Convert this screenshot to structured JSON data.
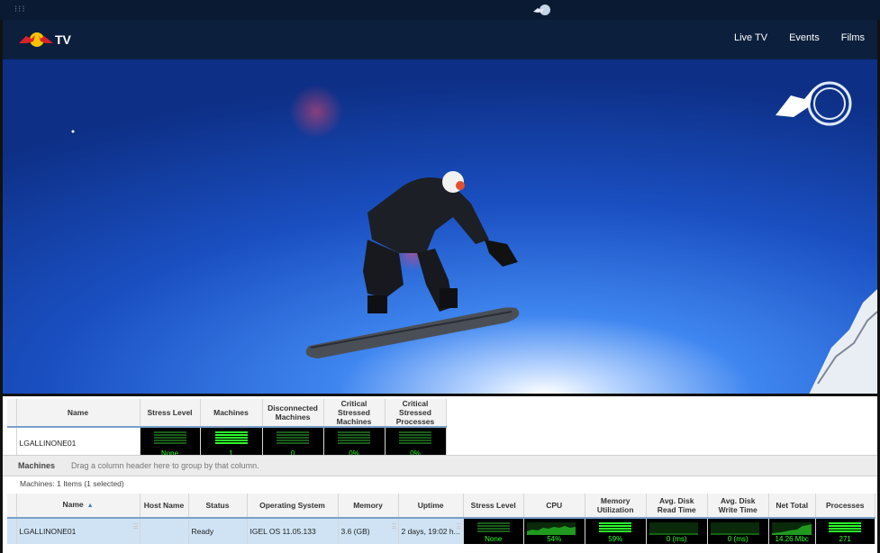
{
  "header": {
    "brand_tv": "TV",
    "nav": [
      "Live TV",
      "Events",
      "Films"
    ]
  },
  "summary": {
    "columns": [
      "Name",
      "Stress Level",
      "Machines",
      "Disconnected Machines",
      "Critical Stressed Machines",
      "Critical Stressed Processes"
    ],
    "row": {
      "name": "LGALLINONE01",
      "stress_level": "None",
      "machines": "1",
      "disconnected": "0",
      "critical_machines": "0%",
      "critical_processes": "0%"
    }
  },
  "groupbar": {
    "label": "Machines",
    "hint": "Drag a column header here to group by that column."
  },
  "count_text": "Machines: 1 Items (1 selected)",
  "machines": {
    "columns": [
      "Name",
      "Host Name",
      "Status",
      "Operating System",
      "Memory",
      "Uptime",
      "Stress Level",
      "CPU",
      "Memory Utilization",
      "Avg. Disk Read Time",
      "Avg. Disk Write Time",
      "Net Total",
      "Processes"
    ],
    "row": {
      "name": "LGALLINONE01",
      "host_name": "",
      "status": "Ready",
      "os": "IGEL OS 11.05.133",
      "memory": "3.6 (GB)",
      "uptime": "2 days, 19:02 h...",
      "stress_level": "None",
      "cpu": "54%",
      "memory_util": "59%",
      "disk_read": "0 (ms)",
      "disk_write": "0 (ms)",
      "net_total": "14.26 Mbc",
      "processes": "271"
    }
  },
  "colors": {
    "meter_green": "#2bff2b",
    "meter_bg": "#000000",
    "header_bg": "#0c1f3d",
    "row_selected": "#cfe3f5"
  }
}
